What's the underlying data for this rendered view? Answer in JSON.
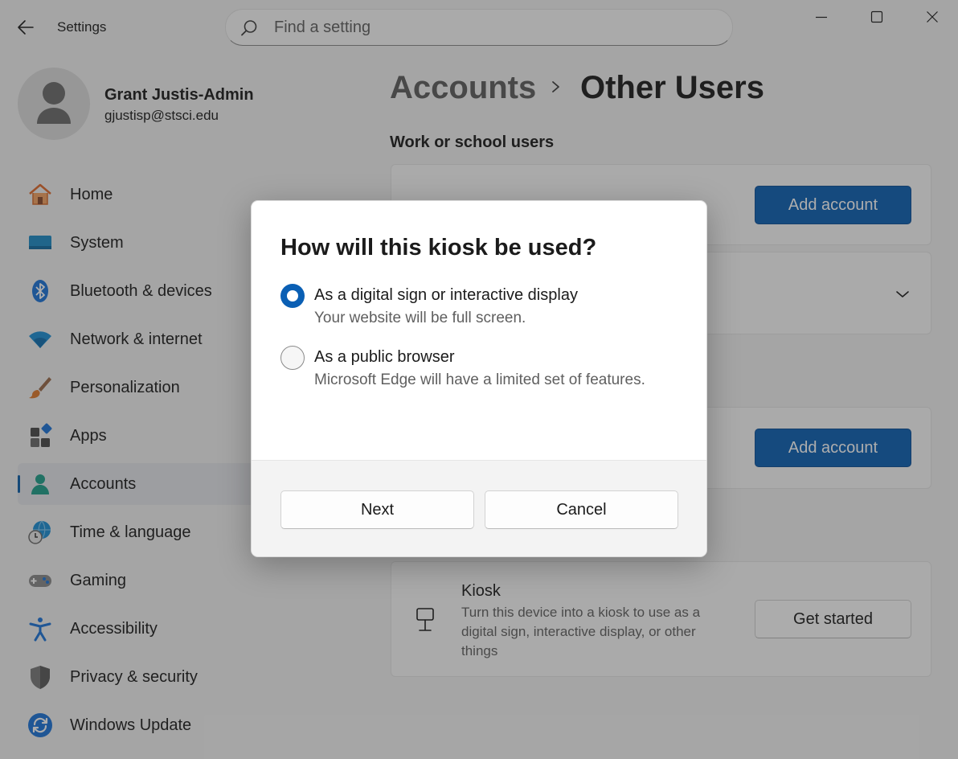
{
  "window": {
    "title": "Settings",
    "controls": {
      "minimize": "minimize-icon",
      "maximize": "maximize-icon",
      "close": "close-icon"
    }
  },
  "search": {
    "placeholder": "Find a setting"
  },
  "profile": {
    "name": "Grant Justis-Admin",
    "email": "gjustisp@stsci.edu"
  },
  "nav": {
    "items": [
      {
        "label": "Home",
        "icon": "home-icon"
      },
      {
        "label": "System",
        "icon": "system-icon"
      },
      {
        "label": "Bluetooth & devices",
        "icon": "bluetooth-icon"
      },
      {
        "label": "Network & internet",
        "icon": "wifi-icon"
      },
      {
        "label": "Personalization",
        "icon": "brush-icon"
      },
      {
        "label": "Apps",
        "icon": "apps-icon"
      },
      {
        "label": "Accounts",
        "icon": "accounts-icon",
        "active": true
      },
      {
        "label": "Time & language",
        "icon": "globe-clock-icon"
      },
      {
        "label": "Gaming",
        "icon": "gamepad-icon"
      },
      {
        "label": "Accessibility",
        "icon": "accessibility-icon"
      },
      {
        "label": "Privacy & security",
        "icon": "shield-icon"
      },
      {
        "label": "Windows Update",
        "icon": "update-icon"
      }
    ]
  },
  "breadcrumb": {
    "parent": "Accounts",
    "current": "Other Users"
  },
  "main": {
    "work_section_title": "Work or school users",
    "add_account_label": "Add account",
    "kiosk": {
      "title": "Kiosk",
      "description": "Turn this device into a kiosk to use as a digital sign, interactive display, or other things",
      "button": "Get started"
    }
  },
  "dialog": {
    "title": "How will this kiosk be used?",
    "options": [
      {
        "label": "As a digital sign or interactive display",
        "description": "Your website will be full screen.",
        "selected": true
      },
      {
        "label": "As a public browser",
        "description": "Microsoft Edge will have a limited set of features.",
        "selected": false
      }
    ],
    "next_label": "Next",
    "cancel_label": "Cancel"
  },
  "colors": {
    "accent": "#0a5fb4",
    "overlay": "rgba(40,40,40,0.38)"
  }
}
